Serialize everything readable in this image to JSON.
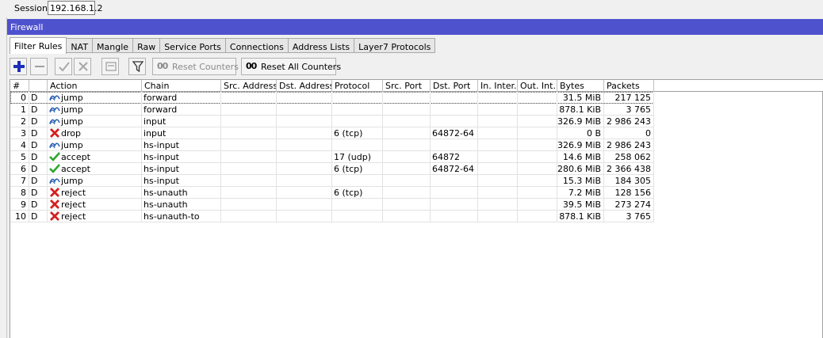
{
  "session": {
    "label": "Session:",
    "value": "192.168.1.2"
  },
  "window": {
    "title": "Firewall"
  },
  "tabs": [
    "Filter Rules",
    "NAT",
    "Mangle",
    "Raw",
    "Service Ports",
    "Connections",
    "Address Lists",
    "Layer7 Protocols"
  ],
  "active_tab": "Filter Rules",
  "toolbar": {
    "reset_counters_icon": "00",
    "reset_counters_label": "Reset Counters",
    "reset_all_counters_icon": "00",
    "reset_all_counters_label": "Reset All Counters"
  },
  "columns": [
    "#",
    "",
    "Action",
    "Chain",
    "Src. Address",
    "Dst. Address",
    "Protocol",
    "Src. Port",
    "Dst. Port",
    "In. Inter...",
    "Out. Int...",
    "Bytes",
    "Packets"
  ],
  "rows": [
    {
      "num": "0",
      "flag": "D",
      "action_icon": "jump",
      "action": "jump",
      "chain": "forward",
      "src_address": "",
      "dst_address": "",
      "protocol": "",
      "src_port": "",
      "dst_port": "",
      "in_interface": "",
      "out_interface": "",
      "bytes": "31.5 MiB",
      "packets": "217 125"
    },
    {
      "num": "1",
      "flag": "D",
      "action_icon": "jump",
      "action": "jump",
      "chain": "forward",
      "src_address": "",
      "dst_address": "",
      "protocol": "",
      "src_port": "",
      "dst_port": "",
      "in_interface": "",
      "out_interface": "",
      "bytes": "878.1 KiB",
      "packets": "3 765"
    },
    {
      "num": "2",
      "flag": "D",
      "action_icon": "jump",
      "action": "jump",
      "chain": "input",
      "src_address": "",
      "dst_address": "",
      "protocol": "",
      "src_port": "",
      "dst_port": "",
      "in_interface": "",
      "out_interface": "",
      "bytes": "326.9 MiB",
      "packets": "2 986 243"
    },
    {
      "num": "3",
      "flag": "D",
      "action_icon": "drop",
      "action": "drop",
      "chain": "input",
      "src_address": "",
      "dst_address": "",
      "protocol": "6 (tcp)",
      "src_port": "",
      "dst_port": "64872-64",
      "in_interface": "",
      "out_interface": "",
      "bytes": "0 B",
      "packets": "0"
    },
    {
      "num": "4",
      "flag": "D",
      "action_icon": "jump",
      "action": "jump",
      "chain": "hs-input",
      "src_address": "",
      "dst_address": "",
      "protocol": "",
      "src_port": "",
      "dst_port": "",
      "in_interface": "",
      "out_interface": "",
      "bytes": "326.9 MiB",
      "packets": "2 986 243"
    },
    {
      "num": "5",
      "flag": "D",
      "action_icon": "accept",
      "action": "accept",
      "chain": "hs-input",
      "src_address": "",
      "dst_address": "",
      "protocol": "17 (udp)",
      "src_port": "",
      "dst_port": "64872",
      "in_interface": "",
      "out_interface": "",
      "bytes": "14.6 MiB",
      "packets": "258 062"
    },
    {
      "num": "6",
      "flag": "D",
      "action_icon": "accept",
      "action": "accept",
      "chain": "hs-input",
      "src_address": "",
      "dst_address": "",
      "protocol": "6 (tcp)",
      "src_port": "",
      "dst_port": "64872-64",
      "in_interface": "",
      "out_interface": "",
      "bytes": "280.6 MiB",
      "packets": "2 366 438"
    },
    {
      "num": "7",
      "flag": "D",
      "action_icon": "jump",
      "action": "jump",
      "chain": "hs-input",
      "src_address": "",
      "dst_address": "",
      "protocol": "",
      "src_port": "",
      "dst_port": "",
      "in_interface": "",
      "out_interface": "",
      "bytes": "15.3 MiB",
      "packets": "184 305"
    },
    {
      "num": "8",
      "flag": "D",
      "action_icon": "reject",
      "action": "reject",
      "chain": "hs-unauth",
      "src_address": "",
      "dst_address": "",
      "protocol": "6 (tcp)",
      "src_port": "",
      "dst_port": "",
      "in_interface": "",
      "out_interface": "",
      "bytes": "7.2 MiB",
      "packets": "128 156"
    },
    {
      "num": "9",
      "flag": "D",
      "action_icon": "reject",
      "action": "reject",
      "chain": "hs-unauth",
      "src_address": "",
      "dst_address": "",
      "protocol": "",
      "src_port": "",
      "dst_port": "",
      "in_interface": "",
      "out_interface": "",
      "bytes": "39.5 MiB",
      "packets": "273 274"
    },
    {
      "num": "10",
      "flag": "D",
      "action_icon": "reject",
      "action": "reject",
      "chain": "hs-unauth-to",
      "src_address": "",
      "dst_address": "",
      "protocol": "",
      "src_port": "",
      "dst_port": "",
      "in_interface": "",
      "out_interface": "",
      "bytes": "878.1 KiB",
      "packets": "3 765"
    }
  ],
  "colors": {
    "title_bar": "#4f52cd",
    "add_icon": "#1b2fb8",
    "accept_icon": "#2fa52f",
    "reject_icon": "#d32020",
    "jump_icon": "#2b5fb0"
  }
}
